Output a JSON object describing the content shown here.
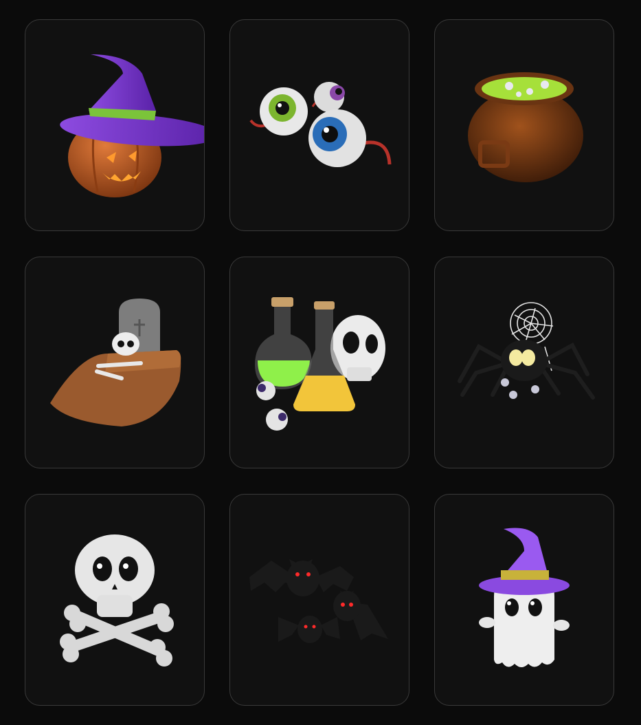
{
  "grid": {
    "items": [
      {
        "icon": "pumpkin-witch-hat-icon"
      },
      {
        "icon": "eyeballs-icon"
      },
      {
        "icon": "cauldron-icon"
      },
      {
        "icon": "grave-skull-icon"
      },
      {
        "icon": "potions-skull-icon"
      },
      {
        "icon": "spider-web-icon"
      },
      {
        "icon": "skull-crossbones-icon"
      },
      {
        "icon": "bats-icon"
      },
      {
        "icon": "ghost-witch-hat-icon"
      }
    ]
  },
  "colors": {
    "background": "#0b0b0b",
    "card": "#111111",
    "card_border": "#3a3a3a",
    "purple": "#7a3fd0",
    "pumpkin": "#d06a2a",
    "slime": "#9be03a"
  }
}
